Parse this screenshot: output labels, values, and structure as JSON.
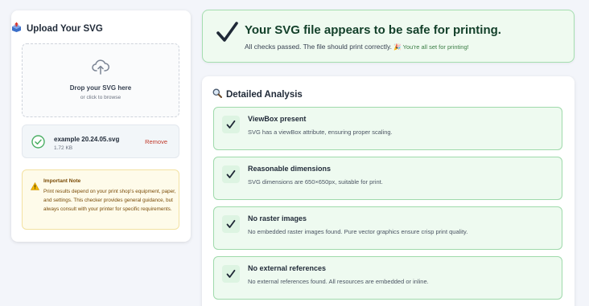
{
  "upload": {
    "title": "Upload Your SVG",
    "drop_main": "Drop your SVG here",
    "drop_sub": "or click to browse"
  },
  "file": {
    "name": "example 20.24.05.svg",
    "size": "1.72 KB",
    "remove_label": "Remove"
  },
  "note": {
    "title": "Important Note",
    "text": "Print results depend on your print shop's equipment, paper, and settings. This checker provides general guidance, but always consult with your printer for specific requirements."
  },
  "banner": {
    "title": "Your SVG file appears to be safe for printing.",
    "subtitle": "All checks passed. The file should print correctly.",
    "celebration": "🎉 You're all set for printing!"
  },
  "analysis": {
    "title": "Detailed Analysis",
    "checks": [
      {
        "title": "ViewBox present",
        "desc": "SVG has a viewBox attribute, ensuring proper scaling."
      },
      {
        "title": "Reasonable dimensions",
        "desc": "SVG dimensions are 650×650px, suitable for print."
      },
      {
        "title": "No raster images",
        "desc": "No embedded raster images found. Pure vector graphics ensure crisp print quality."
      },
      {
        "title": "No external references",
        "desc": "No external references found. All resources are embedded or inline."
      }
    ]
  },
  "icons": {
    "upload_header": "upload-box-icon",
    "cloud": "cloud-upload-icon",
    "file_check": "circle-check-icon",
    "warning": "warning-triangle-icon",
    "magnifier": "magnifier-icon",
    "checkmark": "checkmark-icon"
  },
  "colors": {
    "success_bg": "#effaf0",
    "success_border": "#a5deb0",
    "remove_red": "#c0392b",
    "note_bg": "#fefbea",
    "note_text": "#7a4b06"
  }
}
